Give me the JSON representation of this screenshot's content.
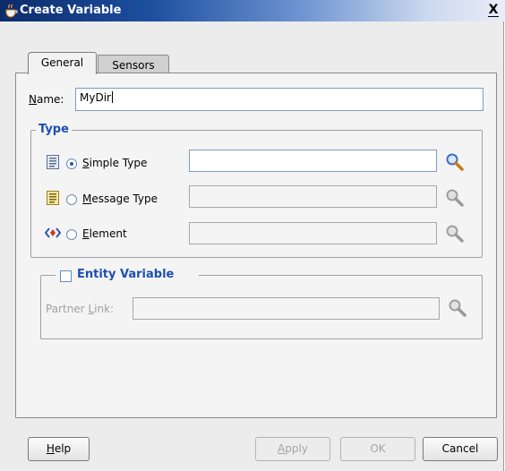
{
  "window": {
    "title": "Create Variable",
    "close_glyph": "X"
  },
  "tabs": [
    {
      "label": "General",
      "active": true
    },
    {
      "label": "Sensors",
      "active": false
    }
  ],
  "name_field": {
    "label_prefix": "N",
    "label_rest": "ame:",
    "value": "MyDir"
  },
  "type_group": {
    "legend": "Type",
    "options": [
      {
        "icon": "simple-type-icon",
        "mnemonic": "S",
        "label_rest": "imple Type",
        "selected": true,
        "value": ""
      },
      {
        "icon": "message-type-icon",
        "mnemonic": "M",
        "label_rest": "essage Type",
        "selected": false,
        "value": ""
      },
      {
        "icon": "element-icon",
        "mnemonic": "E",
        "label_rest": "lement",
        "selected": false,
        "value": ""
      }
    ]
  },
  "entity_group": {
    "legend": "Entity Variable",
    "checked": false,
    "partner_link": {
      "label_prefix": "Partner ",
      "mnemonic": "L",
      "label_rest": "ink:",
      "value": ""
    }
  },
  "buttons": {
    "help": {
      "mnemonic": "H",
      "rest": "elp"
    },
    "apply": {
      "mnemonic": "A",
      "rest": "pply"
    },
    "ok": "OK",
    "cancel": "Cancel"
  },
  "colors": {
    "accent": "#1c4fb3",
    "title_bar_start": "#0c2b6b",
    "search_active": "#3a6fc4",
    "search_disabled": "#a0a0a0"
  }
}
